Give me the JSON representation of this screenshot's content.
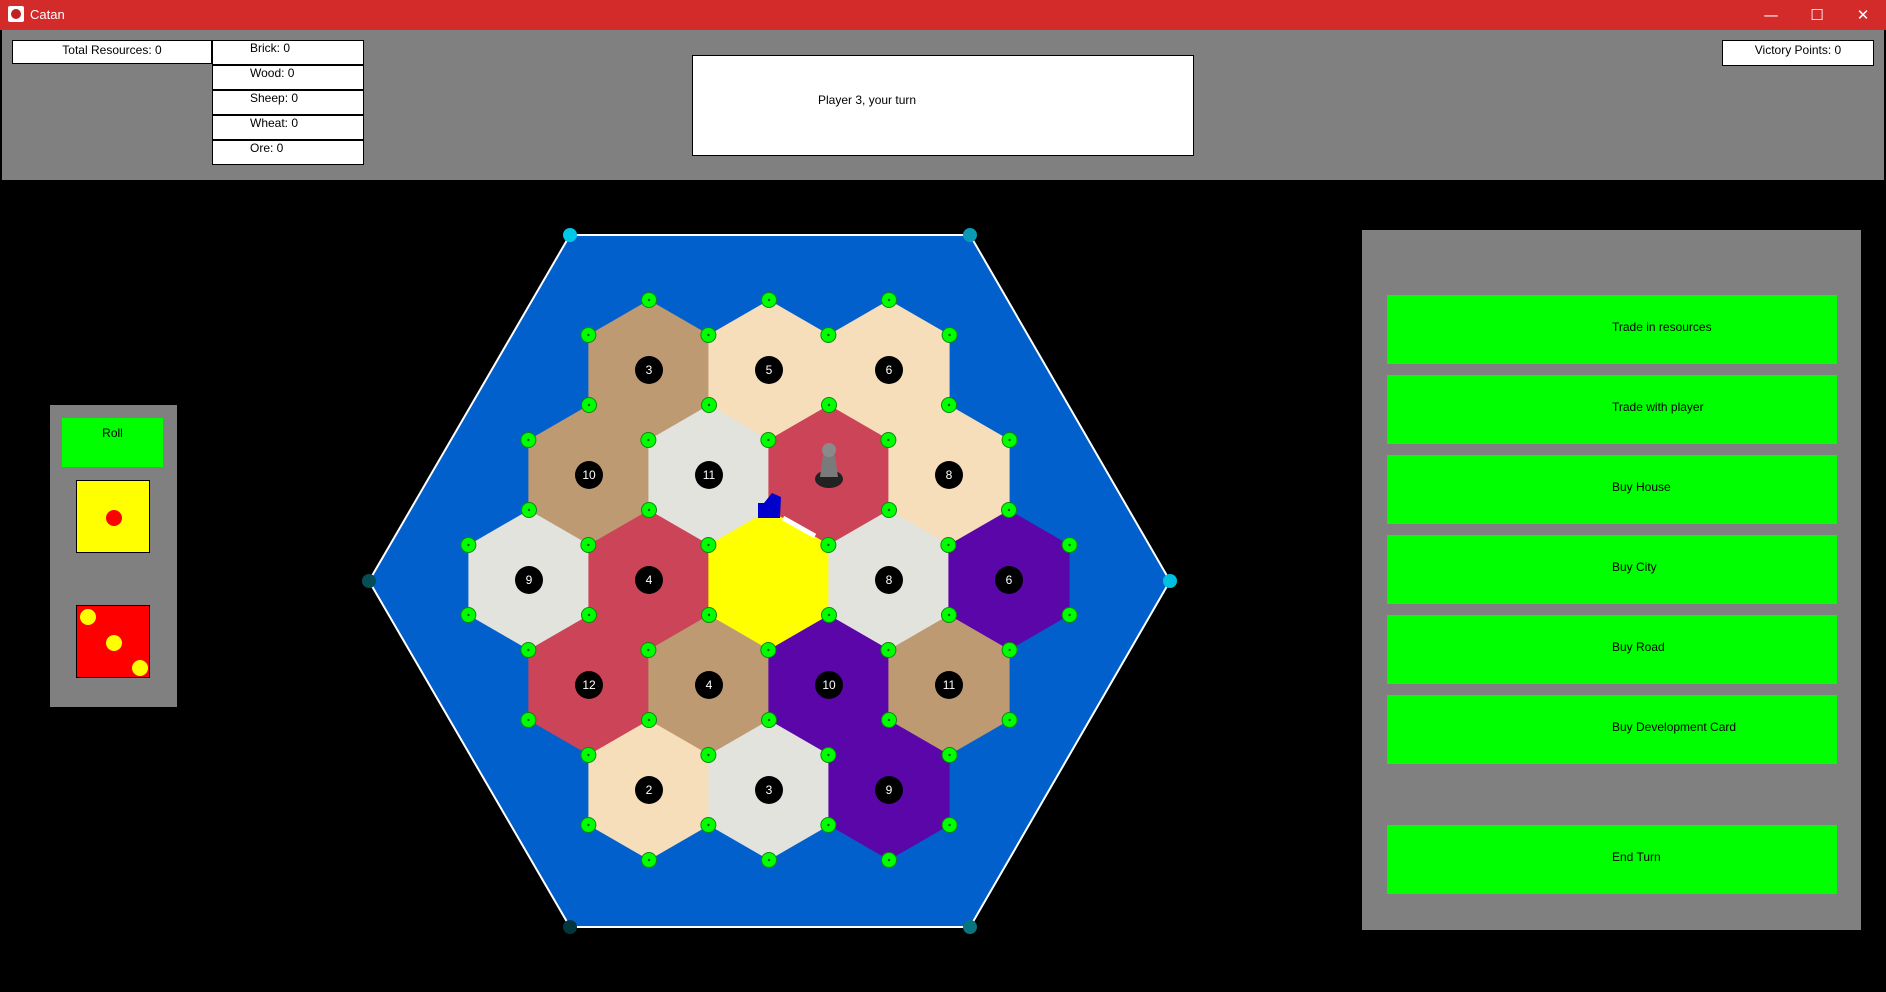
{
  "window": {
    "title": "Catan",
    "minimize_glyph": "—",
    "maximize_glyph": "☐",
    "close_glyph": "✕"
  },
  "status": {
    "total_resources": "Total Resources: 0",
    "resources": [
      "Brick: 0",
      "Wood: 0",
      "Sheep: 0",
      "Wheat: 0",
      "Ore: 0"
    ],
    "message": "Player 3, your turn",
    "victory_points": "Victory Points: 0"
  },
  "dice": {
    "roll_label": "Roll",
    "die1_value": 1,
    "die2_value": 3,
    "die1_color": "#ffff00",
    "die2_color": "#ff0000"
  },
  "actions": {
    "trade_resources": "Trade in resources",
    "trade_player": "Trade with player",
    "buy_house": "Buy House",
    "buy_city": "Buy City",
    "buy_road": "Buy Road",
    "buy_dev_card": "Buy Development Card",
    "end_turn": "End Turn"
  },
  "colors": {
    "brick": "#be9a73",
    "wood": "#f5deb9",
    "sheep": "#e3e3de",
    "wheat": "#cc4458",
    "ore": "#5b06a8",
    "desert": "#ffff00",
    "sea": "#0260cc",
    "node": "#00ff00",
    "action_button": "#00ff00"
  },
  "board": {
    "hex_rows": [
      [
        {
          "type": "brick",
          "number": "3"
        },
        {
          "type": "wood",
          "number": "5"
        },
        {
          "type": "wood",
          "number": "6"
        }
      ],
      [
        {
          "type": "brick",
          "number": "10"
        },
        {
          "type": "sheep",
          "number": "11"
        },
        {
          "type": "wheat",
          "number": "",
          "robber": true
        },
        {
          "type": "wood",
          "number": "8"
        }
      ],
      [
        {
          "type": "sheep",
          "number": "9"
        },
        {
          "type": "wheat",
          "number": "4"
        },
        {
          "type": "desert",
          "number": ""
        },
        {
          "type": "sheep",
          "number": "8"
        },
        {
          "type": "ore",
          "number": "6"
        }
      ],
      [
        {
          "type": "wheat",
          "number": "12"
        },
        {
          "type": "brick",
          "number": "4"
        },
        {
          "type": "ore",
          "number": "10"
        },
        {
          "type": "brick",
          "number": "11"
        }
      ],
      [
        {
          "type": "wood",
          "number": "2"
        },
        {
          "type": "sheep",
          "number": "3"
        },
        {
          "type": "ore",
          "number": "9"
        }
      ]
    ],
    "ports": [
      "#00c8e8",
      "#0a9ab3",
      "#00c0e0",
      "#07747f",
      "#03363c",
      "#054e55"
    ],
    "player_piece_color": "#0000cc"
  }
}
